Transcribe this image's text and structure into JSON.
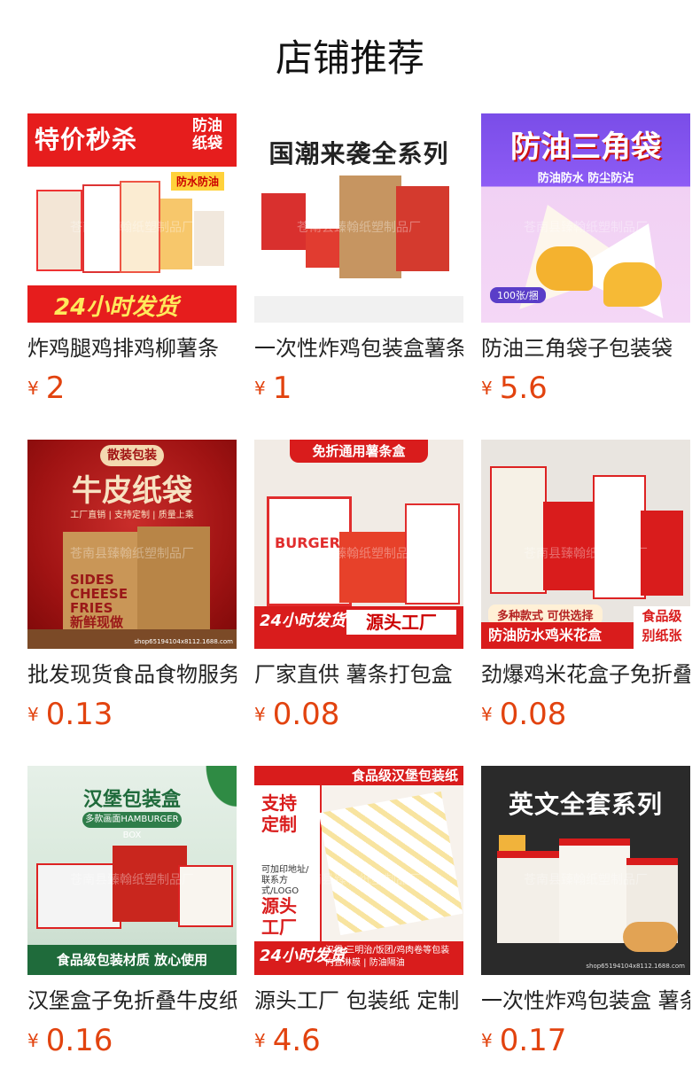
{
  "page": {
    "title": "店铺推荐"
  },
  "products": [
    {
      "name": "炸鸡腿鸡排鸡柳薯条",
      "currency": "¥",
      "price": "2",
      "image": {
        "headline": "特价秒杀",
        "sub": "防油纸袋",
        "tag": "防水防油",
        "footer": "24小时发货"
      }
    },
    {
      "name": "一次性炸鸡包装盒薯条",
      "currency": "¥",
      "price": "1",
      "image": {
        "headline": "国潮来袭全系列"
      }
    },
    {
      "name": "防油三角袋子包装袋",
      "currency": "¥",
      "price": "5.6",
      "image": {
        "headline": "防油三角袋",
        "sub": "防油防水 防尘防沾",
        "badge": "100张/捆"
      }
    },
    {
      "name": "批发现货食品食物服务",
      "currency": "¥",
      "price": "0.13",
      "image": {
        "pill": "散装包装",
        "headline": "牛皮纸袋",
        "sub": "工厂直销 | 支持定制 | 质量上乘",
        "sides": "SIDES\nCHEESE FRIES\n新鲜现做\n很有料!",
        "footer": "shop65194104x8112.1688.com"
      }
    },
    {
      "name": "厂家直供 薯条打包盒",
      "currency": "¥",
      "price": "0.08",
      "image": {
        "headline": "免折通用薯条盒",
        "box_text": "BURGER",
        "left": "24小时发货",
        "right": "源头工厂"
      }
    },
    {
      "name": "劲爆鸡米花盒子免折叠",
      "currency": "¥",
      "price": "0.08",
      "image": {
        "note": "多种款式 可供选择",
        "bottom": "防油防水鸡米花盒",
        "tag": "食品级\n别纸张"
      }
    },
    {
      "name": "汉堡盒子免折叠牛皮纸",
      "currency": "¥",
      "price": "0.16",
      "image": {
        "headline": "汉堡包装盒",
        "pill": "多款画面HAMBURGER BOX",
        "bottom": "食品级包装材质 放心使用"
      }
    },
    {
      "name": "源头工厂 包装纸 定制",
      "currency": "¥",
      "price": "4.6",
      "image": {
        "top": "食品级汉堡包装纸",
        "t1": "支持定制",
        "t2": "可加印地址/联系方式/LOGO",
        "t3": "源头工厂",
        "left": "24小时发货",
        "right": "汉堡/三明治/饭团/鸡肉卷等包装\n内置淋膜 | 防油隔油"
      }
    },
    {
      "name": "一次性炸鸡包装盒 薯条",
      "currency": "¥",
      "price": "0.17",
      "image": {
        "headline": "英文全套系列",
        "footer": "shop65194104x8112.1688.com"
      }
    }
  ],
  "watermark": "苍南县臻翰纸塑制品厂"
}
